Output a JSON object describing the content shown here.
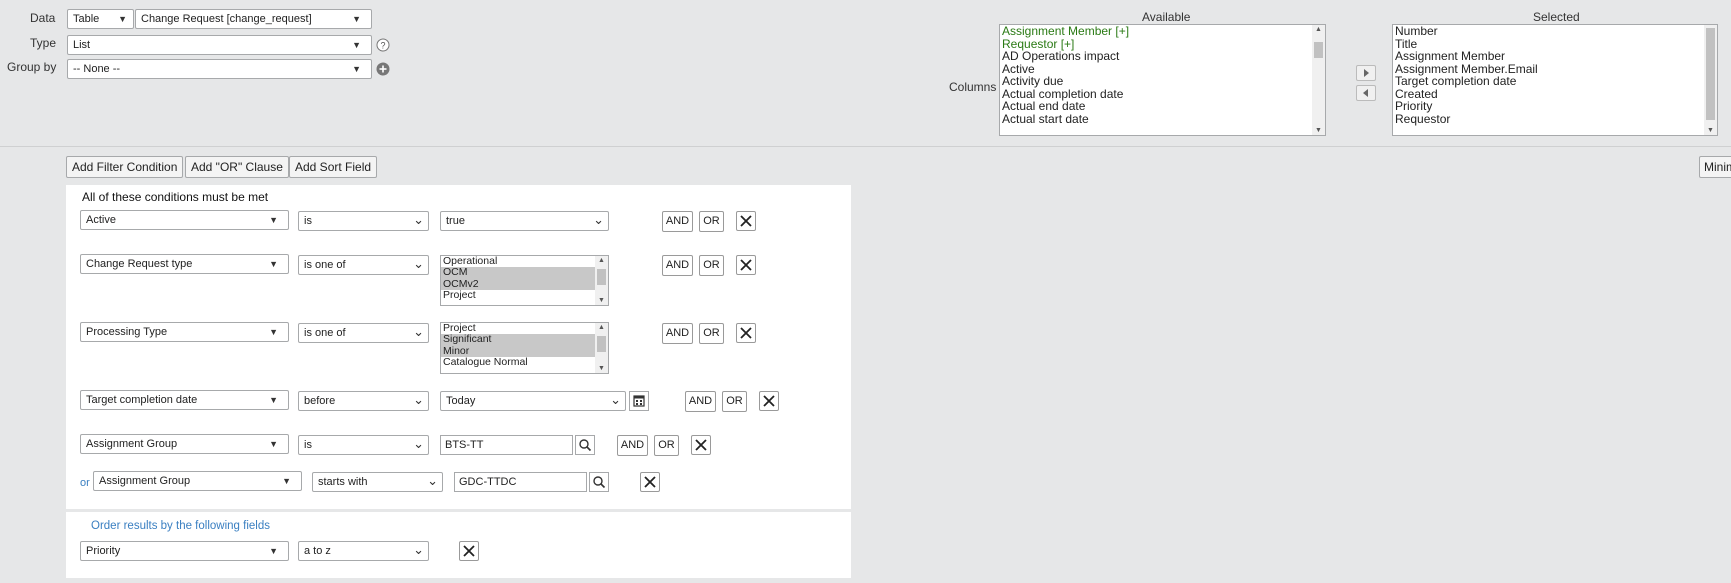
{
  "config": {
    "data_label": "Data",
    "data_source_type": "Table",
    "data_table": "Change Request [change_request]",
    "type_label": "Type",
    "type_value": "List",
    "groupby_label": "Group by",
    "groupby_value": "-- None --"
  },
  "columns": {
    "label": "Columns",
    "available_title": "Available",
    "selected_title": "Selected",
    "available": [
      {
        "text": "Assignment Member [+]",
        "green": true
      },
      {
        "text": "Requestor [+]",
        "green": true
      },
      {
        "text": "AD Operations impact",
        "green": false
      },
      {
        "text": "Active",
        "green": false
      },
      {
        "text": "Activity due",
        "green": false
      },
      {
        "text": "Actual completion date",
        "green": false
      },
      {
        "text": "Actual end date",
        "green": false
      },
      {
        "text": "Actual start date",
        "green": false
      }
    ],
    "selected": [
      "Number",
      "Title",
      "Assignment Member",
      "Assignment Member.Email",
      "Target completion date",
      "Created",
      "Priority",
      "Requestor"
    ]
  },
  "toolbar": {
    "add_filter": "Add Filter Condition",
    "add_or": "Add \"OR\" Clause",
    "add_sort": "Add Sort Field",
    "minimize": "Minim"
  },
  "conditions": {
    "heading": "All of these conditions must be met",
    "and_label": "AND",
    "or_label": "OR",
    "or_prefix": "or",
    "rows": [
      {
        "field": "Active",
        "operator": "is",
        "value": "true"
      },
      {
        "field": "Change Request type",
        "operator": "is one of",
        "options": [
          "Operational",
          "OCM",
          "OCMv2",
          "Project"
        ],
        "selected": [
          1,
          2
        ]
      },
      {
        "field": "Processing Type",
        "operator": "is one of",
        "options": [
          "Project",
          "Significant",
          "Minor",
          "Catalogue Normal"
        ],
        "selected": [
          1,
          2
        ]
      },
      {
        "field": "Target completion date",
        "operator": "before",
        "value": "Today"
      },
      {
        "field": "Assignment Group",
        "operator": "is",
        "value": "BTS-TT"
      },
      {
        "field": "Assignment Group",
        "operator": "starts with",
        "value": "GDC-TTDC"
      }
    ]
  },
  "order": {
    "heading": "Order results by the following fields",
    "field": "Priority",
    "direction": "a to z"
  }
}
